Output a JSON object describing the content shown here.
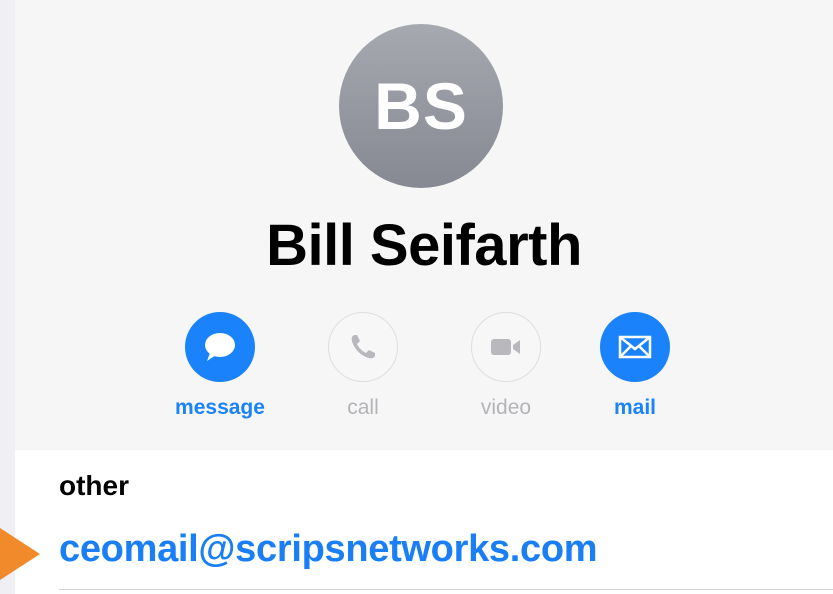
{
  "contact": {
    "initials": "BS",
    "name": "Bill Seifarth"
  },
  "actions": [
    {
      "label": "message",
      "icon": "message-bubble-icon",
      "enabled": true
    },
    {
      "label": "call",
      "icon": "phone-icon",
      "enabled": false
    },
    {
      "label": "video",
      "icon": "video-camera-icon",
      "enabled": false
    },
    {
      "label": "mail",
      "icon": "envelope-icon",
      "enabled": true
    }
  ],
  "email_field": {
    "label": "other",
    "value": "ceomail@scripsnetworks.com"
  },
  "colors": {
    "accent": "#1a82fb",
    "disabled": "#b4b4b8",
    "pointer_arrow": "#f08a2a"
  }
}
